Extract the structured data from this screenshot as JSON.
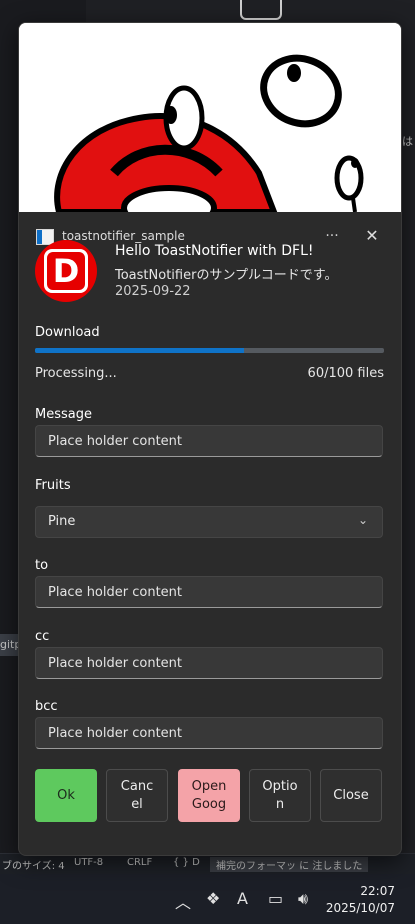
{
  "toast": {
    "app_name": "toastnotifier_sample",
    "more_label": "···",
    "close_label": "✕",
    "logo_letter": "D",
    "title": "Hello ToastNotifier with DFL!",
    "body": "ToastNotifierのサンプルコードです。",
    "attribution": "2025-09-22",
    "progress": {
      "title": "Download",
      "status": "Processing...",
      "value_text": "60/100 files",
      "fraction": 0.6
    },
    "fields": {
      "message": {
        "label": "Message",
        "placeholder": "Place holder content"
      },
      "fruits": {
        "label": "Fruits",
        "selected": "Pine"
      },
      "to": {
        "label": "to",
        "placeholder": "Place holder content"
      },
      "cc": {
        "label": "cc",
        "placeholder": "Place holder content"
      },
      "bcc": {
        "label": "bcc",
        "placeholder": "Place holder content"
      }
    },
    "buttons": {
      "ok": "Ok",
      "cancel": "Canc\nel",
      "open": "Open\nGoog",
      "option": "Optio\nn",
      "close": "Close"
    },
    "colors": {
      "accent": "#0f73c8",
      "ok_button": "#5ec95e",
      "open_button": "#f4a3a8",
      "logo_red": "#e60000"
    }
  },
  "background": {
    "side_text_1": "gitp",
    "side_text_2": "は"
  },
  "statusbar": {
    "tab_size": "ブのサイズ: 4",
    "encoding": "UTF-8",
    "eol": "CRLF",
    "language": "{ } D",
    "notification": "補完のフォーマッ に 注しました"
  },
  "taskbar": {
    "time": "22:07",
    "date": "2025/10/07"
  }
}
